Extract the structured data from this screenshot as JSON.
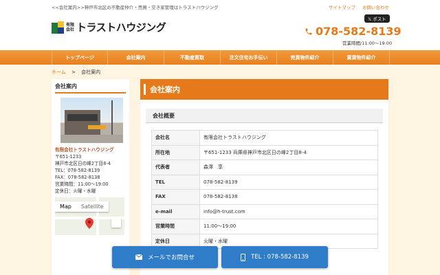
{
  "topbar": {
    "breadcrumb": "<<会社案内>>神戸市北区の不動産仲介・売買・空き家管理はトラストハウジング",
    "sitemap": "サイトマップ",
    "contact": "お問い合わせ"
  },
  "header": {
    "logo_small_1": "有限",
    "logo_small_2": "会社",
    "logo_name": "トラストハウジング",
    "post_label": "𝕏 ポスト",
    "phone": "078-582-8139",
    "hours": "営業時間/11:00～19:00"
  },
  "nav": [
    "トップページ",
    "会社案内",
    "不動産買取",
    "注文住宅お手伝い",
    "売買物件紹介",
    "賃貸物件紹介"
  ],
  "crumb": {
    "home": "ホーム",
    "sep": ">",
    "current": "会社案内"
  },
  "side": {
    "title": "会社案内",
    "company": "有限会社トラストハウジング",
    "lines": [
      "〒651-1233",
      "神戸市北区日の峰2丁目8-4",
      "TEL：078-582-8139",
      "FAX：078-582-8138",
      "営業時間：11:00～19:00",
      "定休日：火曜・水曜"
    ],
    "map_tab_map": "Map",
    "map_tab_sat": "Satellite"
  },
  "main": {
    "title": "会社案内",
    "section": "会社概要",
    "rows": [
      {
        "k": "会社名",
        "v": "有限会社トラストハウジング"
      },
      {
        "k": "所在地",
        "v": "〒651-1233 兵庫県神戸市北区日の峰2丁目8-4"
      },
      {
        "k": "代表者",
        "v": "森澤　享"
      },
      {
        "k": "TEL",
        "v": "078-582-8139"
      },
      {
        "k": "FAX",
        "v": "078-582-8138"
      },
      {
        "k": "e-mail",
        "v": "info@h-trust.com"
      },
      {
        "k": "営業時間",
        "v": "11:00～19:00"
      },
      {
        "k": "定休日",
        "v": "火曜・水曜"
      }
    ]
  },
  "cta": {
    "mail": "メールでお問合せ",
    "tel": "TEL : 078-582-8139"
  },
  "colors": {
    "accent": "#e67a1a",
    "cta": "#2f7cc9",
    "page_bg": "#fdf4e2"
  }
}
